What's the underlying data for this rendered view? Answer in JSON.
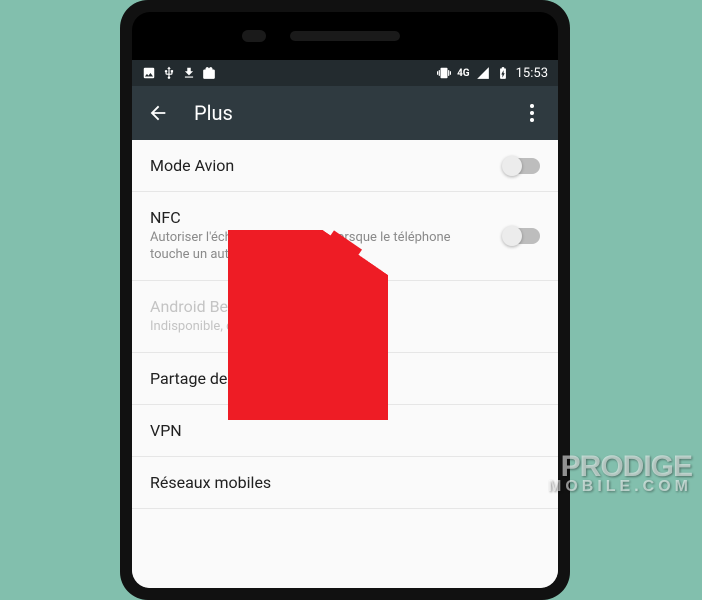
{
  "statusbar": {
    "time": "15:53",
    "network_label": "4G"
  },
  "appbar": {
    "title": "Plus"
  },
  "rows": {
    "airplane": {
      "title": "Mode Avion"
    },
    "nfc": {
      "title": "NFC",
      "sub": "Autoriser l'échange de données lorsque le téléphone touche un autre appareil"
    },
    "beam": {
      "title": "Android Beam",
      "sub": "Indisponible, car la NFC est désactivée"
    },
    "tether": {
      "title": "Partage de connexion"
    },
    "vpn": {
      "title": "VPN"
    },
    "mobile": {
      "title": "Réseaux mobiles"
    }
  },
  "watermark": {
    "line1": "PRODIGE",
    "line2": "MOBILE.COM"
  }
}
